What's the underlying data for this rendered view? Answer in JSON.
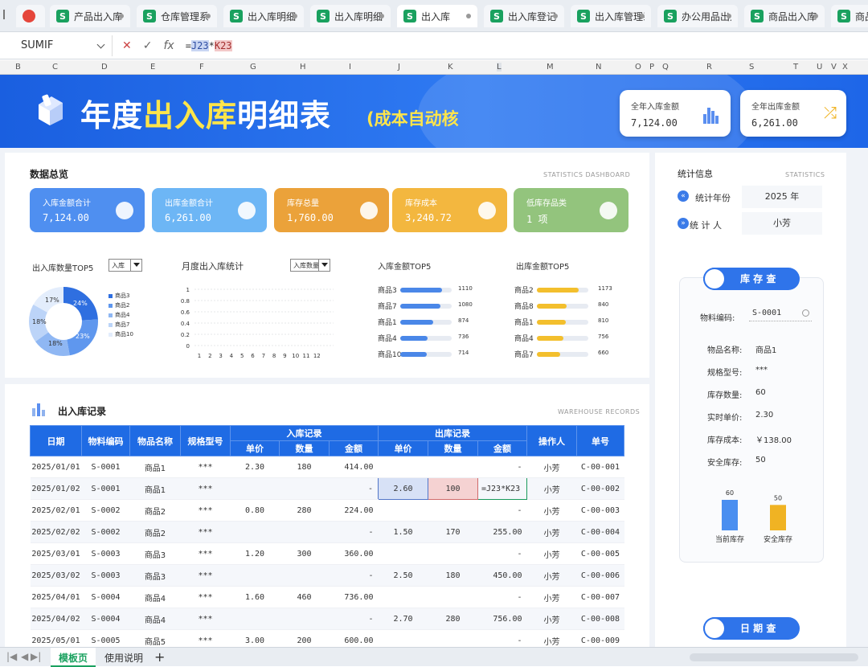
{
  "tabs": [
    {
      "label": "产品出入库"
    },
    {
      "label": "仓库管理系"
    },
    {
      "label": "出入库明细"
    },
    {
      "label": "出入库明细"
    },
    {
      "label": "出入库"
    },
    {
      "label": "出入库登记"
    },
    {
      "label": "出入库管理系"
    },
    {
      "label": "办公用品出入"
    },
    {
      "label": "商品出入库"
    },
    {
      "label": "商品出"
    }
  ],
  "formula_bar": {
    "name_box": "SUMIF",
    "fx": "fx",
    "formula_prefix": "=",
    "ref1": "J23",
    "op": "*",
    "ref2": "K23"
  },
  "columns": [
    "B",
    "C",
    "D",
    "E",
    "F",
    "G",
    "H",
    "I",
    "J",
    "K",
    "L",
    "M",
    "N",
    "O",
    "P",
    "Q",
    "R",
    "S",
    "T",
    "U",
    "V",
    "X"
  ],
  "banner": {
    "title_a": "年度",
    "title_b": "出入库",
    "title_c": "明细表",
    "subtitle": "(成本自动核",
    "card_in": {
      "label": "全年入库金额",
      "value": "7,124.00"
    },
    "card_out": {
      "label": "全年出库金额",
      "value": "6,261.00"
    }
  },
  "overview": {
    "title": "数据总览",
    "tag": "STATISTICS  DASHBOARD",
    "kpis": [
      {
        "label": "入库金额合计",
        "value": "7,124.00",
        "color": "#4f8ff0"
      },
      {
        "label": "出库金额合计",
        "value": "6,261.00",
        "color": "#6db6f5"
      },
      {
        "label": "库存总量",
        "value": "1,760.00",
        "color": "#eba23a"
      },
      {
        "label": "库存成本",
        "value": "3,240.72",
        "color": "#f3b73f"
      },
      {
        "label": "低库存品类",
        "value": "1 项",
        "color": "#93c47d"
      }
    ]
  },
  "donut": {
    "title": "出入库数量TOP5",
    "select": "入库",
    "legend": [
      "商品3",
      "商品2",
      "商品4",
      "商品7",
      "商品10"
    ],
    "labels": [
      "24%",
      "23%",
      "18%",
      "18%",
      "17%"
    ]
  },
  "monthly": {
    "title": "月度出入库统计",
    "select": "入库数量",
    "yticks": [
      "1",
      "0.8",
      "0.6",
      "0.4",
      "0.2",
      "0"
    ],
    "xticks": [
      "1",
      "2",
      "3",
      "4",
      "5",
      "6",
      "7",
      "8",
      "9",
      "10",
      "11",
      "12"
    ]
  },
  "in_top5": {
    "title": "入库金额TOP5",
    "items": [
      {
        "name": "商品3",
        "value": "1110",
        "frac": 1.0
      },
      {
        "name": "商品7",
        "value": "1080",
        "frac": 0.97
      },
      {
        "name": "商品1",
        "value": "874",
        "frac": 0.79
      },
      {
        "name": "商品4",
        "value": "736",
        "frac": 0.66
      },
      {
        "name": "商品10",
        "value": "714",
        "frac": 0.64
      }
    ]
  },
  "out_top5": {
    "title": "出库金额TOP5",
    "items": [
      {
        "name": "商品2",
        "value": "1173",
        "frac": 1.0
      },
      {
        "name": "商品8",
        "value": "840",
        "frac": 0.72
      },
      {
        "name": "商品1",
        "value": "810",
        "frac": 0.69
      },
      {
        "name": "商品4",
        "value": "756",
        "frac": 0.64
      },
      {
        "name": "商品7",
        "value": "660",
        "frac": 0.56
      }
    ]
  },
  "records": {
    "title": "出入库记录",
    "tag": "WAREHOUSE RECORDS",
    "headers": {
      "date": "日期",
      "code": "物料编码",
      "name": "物品名称",
      "spec": "规格型号",
      "in_group": "入库记录",
      "out_group": "出库记录",
      "price": "单价",
      "qty": "数量",
      "amount": "金额",
      "operator": "操作人",
      "doc": "单号"
    },
    "rows": [
      [
        "2025/01/01",
        "S-0001",
        "商品1",
        "***",
        "2.30",
        "180",
        "414.00",
        "",
        "",
        "-",
        "小芳",
        "C-00-001"
      ],
      [
        "2025/01/02",
        "S-0001",
        "商品1",
        "***",
        "",
        "",
        "-",
        "2.60",
        "100",
        "=J23*K23",
        "小芳",
        "C-00-002"
      ],
      [
        "2025/02/01",
        "S-0002",
        "商品2",
        "***",
        "0.80",
        "280",
        "224.00",
        "",
        "",
        "-",
        "小芳",
        "C-00-003"
      ],
      [
        "2025/02/02",
        "S-0002",
        "商品2",
        "***",
        "",
        "",
        "-",
        "1.50",
        "170",
        "255.00",
        "小芳",
        "C-00-004"
      ],
      [
        "2025/03/01",
        "S-0003",
        "商品3",
        "***",
        "1.20",
        "300",
        "360.00",
        "",
        "",
        "-",
        "小芳",
        "C-00-005"
      ],
      [
        "2025/03/02",
        "S-0003",
        "商品3",
        "***",
        "",
        "",
        "-",
        "2.50",
        "180",
        "450.00",
        "小芳",
        "C-00-006"
      ],
      [
        "2025/04/01",
        "S-0004",
        "商品4",
        "***",
        "1.60",
        "460",
        "736.00",
        "",
        "",
        "-",
        "小芳",
        "C-00-007"
      ],
      [
        "2025/04/02",
        "S-0004",
        "商品4",
        "***",
        "",
        "",
        "-",
        "2.70",
        "280",
        "756.00",
        "小芳",
        "C-00-008"
      ],
      [
        "2025/05/01",
        "S-0005",
        "商品5",
        "***",
        "3.00",
        "200",
        "600.00",
        "",
        "",
        "-",
        "小芳",
        "C-00-009"
      ]
    ]
  },
  "stats": {
    "title": "统计信息",
    "tag": "STATISTICS",
    "year_label": "统计年份",
    "year_value": "2025 年",
    "person_label": "统 计 人",
    "person_value": "小芳"
  },
  "inventory": {
    "button": "库 存 查",
    "code_label": "物料编码:",
    "code_value": "S-0001",
    "fields": [
      {
        "label": "物品名称:",
        "value": "商品1"
      },
      {
        "label": "规格型号:",
        "value": "***"
      },
      {
        "label": "库存数量:",
        "value": "60"
      },
      {
        "label": "实时单价:",
        "value": "2.30"
      },
      {
        "label": "库存成本:",
        "value": "￥138.00"
      },
      {
        "label": "安全库存:",
        "value": "50"
      }
    ],
    "bars": [
      {
        "name": "当前库存",
        "value": 60,
        "label": "60",
        "color": "#4a8ff0"
      },
      {
        "name": "安全库存",
        "value": 50,
        "label": "50",
        "color": "#f0b323"
      }
    ],
    "date_button": "日 期 查"
  },
  "sheets": {
    "active": "模板页",
    "other": "使用说明",
    "add": "+"
  }
}
